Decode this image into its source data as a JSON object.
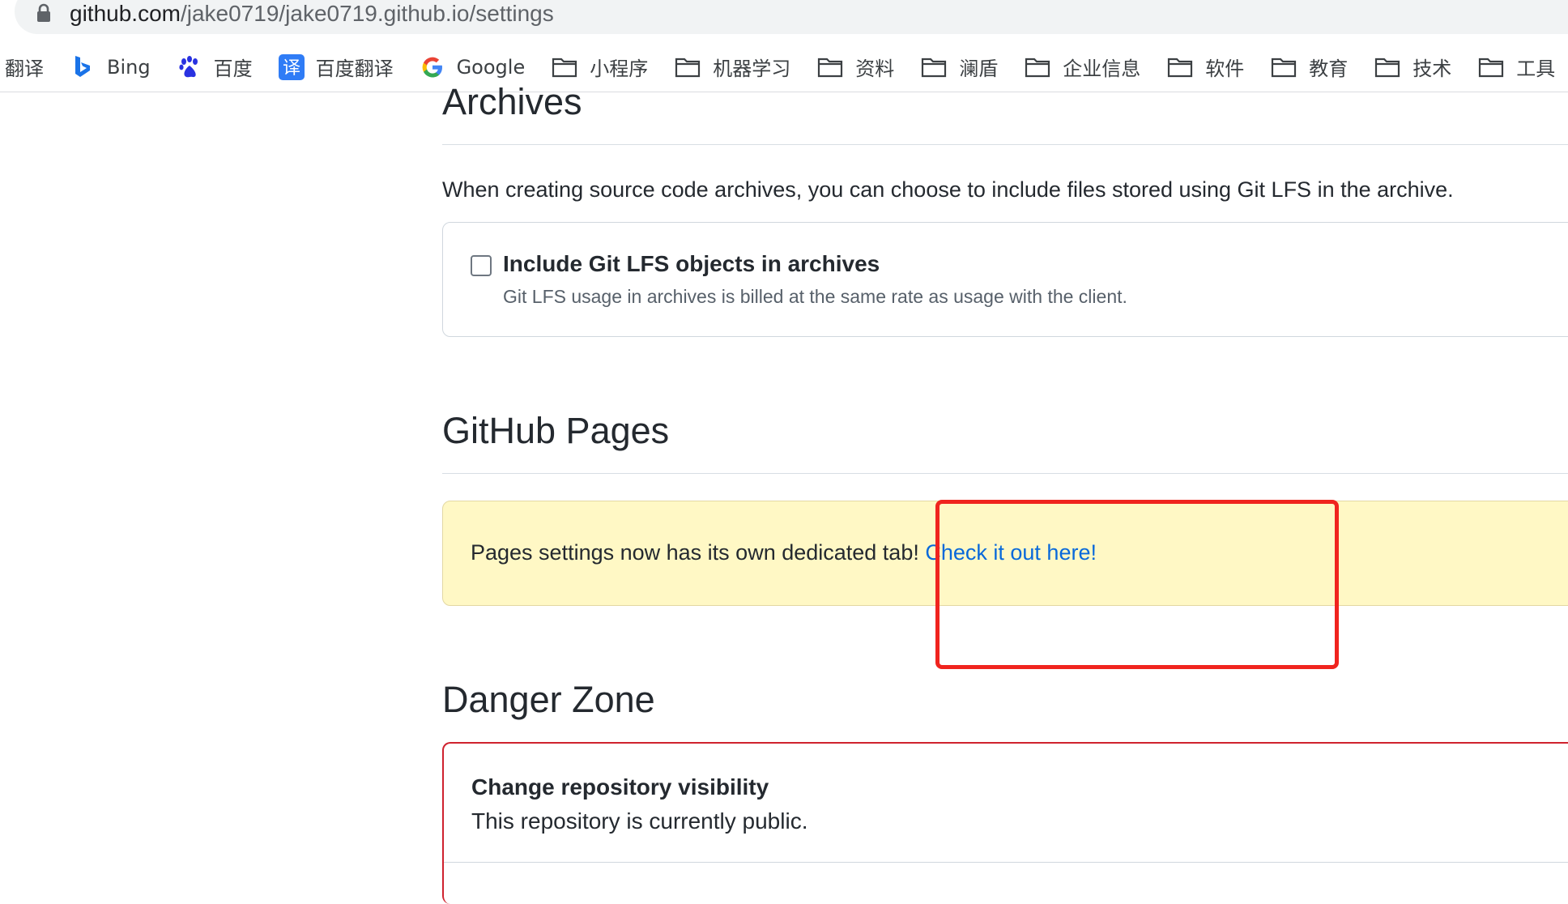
{
  "browser": {
    "url_host": "github.com",
    "url_path": "/jake0719/jake0719.github.io/settings",
    "lock_icon": "lock-icon"
  },
  "bookmarks": [
    {
      "label": "翻译",
      "icon": "none"
    },
    {
      "label": "Bing",
      "icon": "bing-icon"
    },
    {
      "label": "百度",
      "icon": "baidu-icon"
    },
    {
      "label": "百度翻译",
      "icon": "translate-icon"
    },
    {
      "label": "Google",
      "icon": "google-icon"
    },
    {
      "label": "小程序",
      "icon": "folder-icon"
    },
    {
      "label": "机器学习",
      "icon": "folder-icon"
    },
    {
      "label": "资料",
      "icon": "folder-icon"
    },
    {
      "label": "澜盾",
      "icon": "folder-icon"
    },
    {
      "label": "企业信息",
      "icon": "folder-icon"
    },
    {
      "label": "软件",
      "icon": "folder-icon"
    },
    {
      "label": "教育",
      "icon": "folder-icon"
    },
    {
      "label": "技术",
      "icon": "folder-icon"
    },
    {
      "label": "工具",
      "icon": "folder-icon"
    }
  ],
  "archives": {
    "title": "Archives",
    "description": "When creating source code archives, you can choose to include files stored using Git LFS in the archive.",
    "lfs_label": "Include Git LFS objects in archives",
    "lfs_note": "Git LFS usage in archives is billed at the same rate as usage with the client.",
    "lfs_checked": false
  },
  "pages": {
    "title": "GitHub Pages",
    "flash_text": "Pages settings now has its own dedicated tab! ",
    "flash_link": "Check it out here!"
  },
  "danger": {
    "title": "Danger Zone",
    "item_title": "Change repository visibility",
    "item_desc": "This repository is currently public."
  },
  "colors": {
    "link": "#0969da",
    "flash_bg": "#fff8c5",
    "danger_border": "#cf222e",
    "annotation": "#f0241e"
  }
}
